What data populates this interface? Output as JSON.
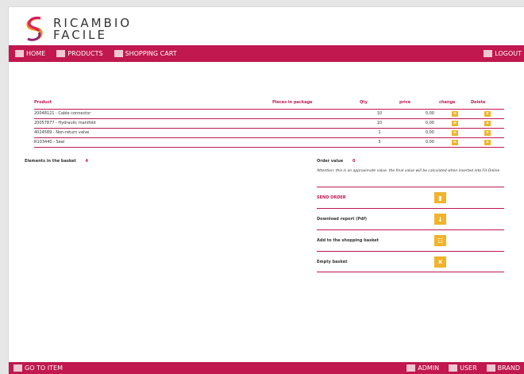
{
  "brand": {
    "line1": "RICAMBIO",
    "line2": "FACILE"
  },
  "topnav": {
    "home": "HOME",
    "products": "PRODUCTS",
    "cart": "SHOPPING CART",
    "logout": "LOGOUT"
  },
  "table": {
    "headers": {
      "product": "Product",
      "pieces": "Pieces in package",
      "qty": "Qty",
      "price": "price",
      "change": "change",
      "delete": "Delete"
    },
    "rows": [
      {
        "product": "20048121 - Cable connector",
        "pieces": "",
        "qty": "10",
        "price": "0,00"
      },
      {
        "product": "20057877 - Hydraulic manifold",
        "pieces": "",
        "qty": "10",
        "price": "0,00"
      },
      {
        "product": "4024589 - Non-return valve",
        "pieces": "",
        "qty": "1",
        "price": "0,00"
      },
      {
        "product": "R103440 - Seal",
        "pieces": "",
        "qty": "3",
        "price": "0,00"
      }
    ]
  },
  "summary": {
    "elements_label": "Elements in the basket",
    "elements_count": "4",
    "order_label": "Order value",
    "order_value": "0",
    "note": "Attention: this is an approximate value, the final value will be calculated when inserted into Fit-Online"
  },
  "actions": {
    "send": "SEND ORDER",
    "download": "Download report (Pdf)",
    "add": "Add to the shopping basket",
    "empty": "Empty basket"
  },
  "bottomnav": {
    "goto": "GO TO ITEM",
    "admin": "ADMIN",
    "user": "USER",
    "brand": "BRAND"
  },
  "colors": {
    "accent": "#c0184f",
    "button": "#f0b32a"
  }
}
